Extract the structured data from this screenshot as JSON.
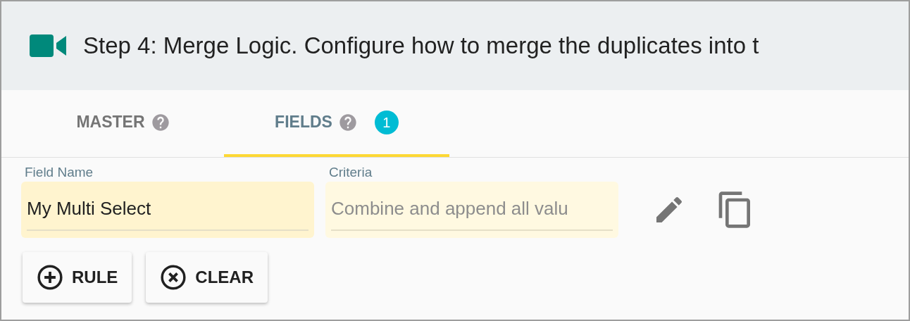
{
  "header": {
    "title": "Step 4: Merge Logic. Configure how to merge the duplicates into t"
  },
  "tabs": [
    {
      "label": "MASTER",
      "selected": false
    },
    {
      "label": "FIELDS",
      "selected": true,
      "badge": "1"
    }
  ],
  "fields": [
    {
      "label": "Field Name",
      "value": "My Multi Select",
      "disabled": false
    },
    {
      "label": "Criteria",
      "value": "Combine and append all valu",
      "disabled": true
    }
  ],
  "buttons": [
    {
      "label": "RULE",
      "kind": "add"
    },
    {
      "label": "CLEAR",
      "kind": "clear"
    }
  ]
}
